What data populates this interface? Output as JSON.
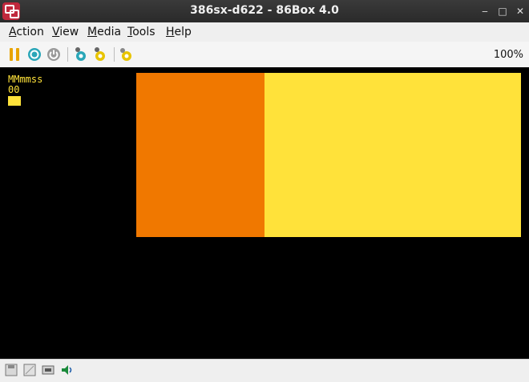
{
  "window": {
    "title": "386sx-d622 - 86Box 4.0",
    "controls": {
      "minimize": "‒",
      "maximize": "□",
      "close": "✕"
    }
  },
  "menu": [
    {
      "label": "Action",
      "underline": "A",
      "rest": "ction"
    },
    {
      "label": "View",
      "underline": "V",
      "rest": "iew"
    },
    {
      "label": "Media",
      "underline": "M",
      "rest": "edia"
    },
    {
      "label": "Tools",
      "underline": "T",
      "rest": "ools"
    },
    {
      "label": "Help",
      "underline": "H",
      "rest": "elp"
    }
  ],
  "toolbar": {
    "icons": [
      "pause-icon",
      "ctrl-alt-del-icon",
      "power-icon",
      "settings-icon",
      "hard-reset-icon",
      "acpi-shutdown-icon"
    ],
    "zoom": "100%"
  },
  "screen": {
    "line1": "MMmmss",
    "line2": "00",
    "colors": {
      "orange": "#f07800",
      "yellow": "#ffe23a",
      "background": "#000000"
    }
  },
  "statusbar": {
    "icons": [
      "floppy-drive-icon",
      "cdrom-drive-icon",
      "network-icon",
      "sound-icon"
    ]
  }
}
